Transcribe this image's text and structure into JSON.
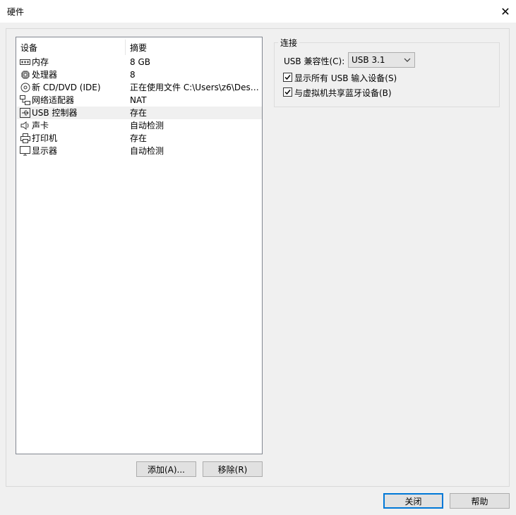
{
  "window": {
    "title": "硬件",
    "close_glyph": "✕"
  },
  "device_list": {
    "columns": [
      "设备",
      "摘要"
    ],
    "rows": [
      {
        "icon": "memory-icon",
        "name": "内存",
        "summary": "8 GB"
      },
      {
        "icon": "cpu-icon",
        "name": "处理器",
        "summary": "8"
      },
      {
        "icon": "disc-icon",
        "name": "新 CD/DVD (IDE)",
        "summary": "正在使用文件 C:\\Users\\z6\\Desk..."
      },
      {
        "icon": "network-icon",
        "name": "网络适配器",
        "summary": "NAT"
      },
      {
        "icon": "usb-icon",
        "name": "USB 控制器",
        "summary": "存在",
        "selected": true
      },
      {
        "icon": "speaker-icon",
        "name": "声卡",
        "summary": "自动检测"
      },
      {
        "icon": "printer-icon",
        "name": "打印机",
        "summary": "存在"
      },
      {
        "icon": "monitor-icon",
        "name": "显示器",
        "summary": "自动检测"
      }
    ]
  },
  "buttons": {
    "add": "添加(A)...",
    "remove": "移除(R)",
    "close": "关闭",
    "help": "帮助"
  },
  "connection": {
    "group_title": "连接",
    "compat_label": "USB 兼容性(C):",
    "compat_value": "USB 3.1",
    "show_all_usb": {
      "label": "显示所有 USB 输入设备(S)",
      "checked": true
    },
    "share_bluetooth": {
      "label": "与虚拟机共享蓝牙设备(B)",
      "checked": true
    }
  },
  "colors": {
    "accent": "#0078d7",
    "selected_row": "#f0f0f0"
  }
}
